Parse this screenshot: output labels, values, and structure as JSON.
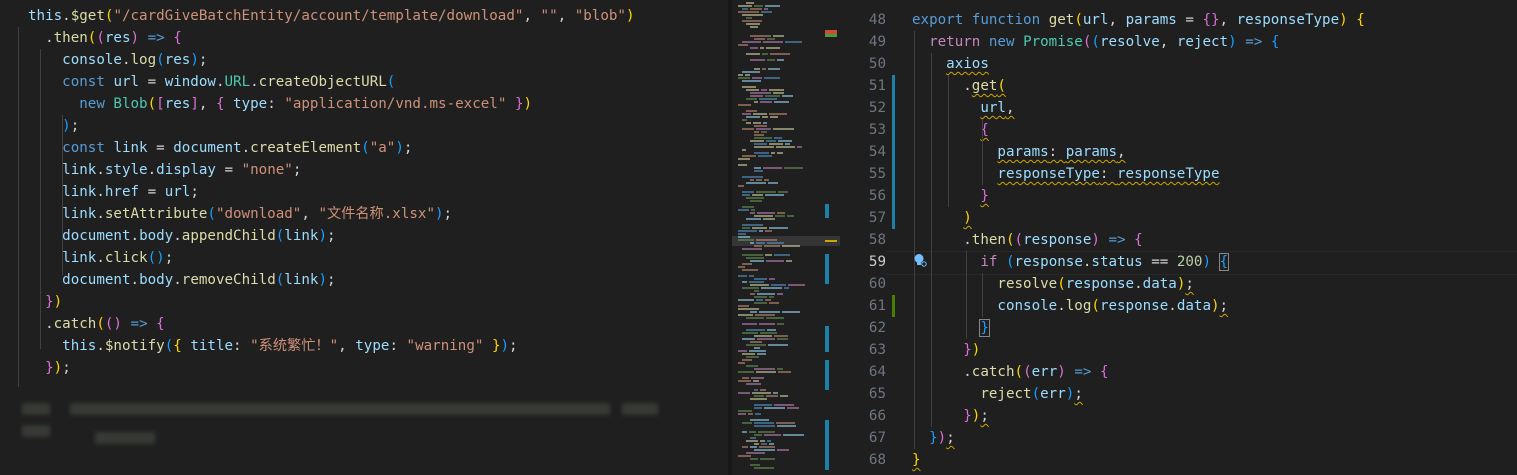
{
  "left": {
    "lines": [
      [
        [
          "var",
          "this"
        ],
        [
          "op",
          "."
        ],
        [
          "fn",
          "$get"
        ],
        [
          "b1",
          "("
        ],
        [
          "str",
          "\"/cardGiveBatchEntity/account/template/download\""
        ],
        [
          "op",
          ", "
        ],
        [
          "str",
          "\"\""
        ],
        [
          "op",
          ", "
        ],
        [
          "str",
          "\"blob\""
        ],
        [
          "b1",
          ")"
        ]
      ],
      [
        [
          "op",
          "  ."
        ],
        [
          "fn",
          "then"
        ],
        [
          "b1",
          "("
        ],
        [
          "b2",
          "("
        ],
        [
          "var",
          "res"
        ],
        [
          "b2",
          ")"
        ],
        [
          "op",
          " "
        ],
        [
          "kw",
          "=>"
        ],
        [
          "op",
          " "
        ],
        [
          "b2",
          "{"
        ]
      ],
      [
        [
          "op",
          "    "
        ],
        [
          "var",
          "console"
        ],
        [
          "op",
          "."
        ],
        [
          "fn",
          "log"
        ],
        [
          "b3",
          "("
        ],
        [
          "var",
          "res"
        ],
        [
          "b3",
          ")"
        ],
        [
          "op",
          ";"
        ]
      ],
      [
        [
          "op",
          "    "
        ],
        [
          "kw",
          "const"
        ],
        [
          "op",
          " "
        ],
        [
          "var",
          "url"
        ],
        [
          "op",
          " = "
        ],
        [
          "var",
          "window"
        ],
        [
          "op",
          "."
        ],
        [
          "cls",
          "URL"
        ],
        [
          "op",
          "."
        ],
        [
          "fn",
          "createObjectURL"
        ],
        [
          "b3",
          "("
        ]
      ],
      [
        [
          "op",
          "      "
        ],
        [
          "kw",
          "new"
        ],
        [
          "op",
          " "
        ],
        [
          "cls",
          "Blob"
        ],
        [
          "b1",
          "("
        ],
        [
          "b2",
          "["
        ],
        [
          "var",
          "res"
        ],
        [
          "b2",
          "]"
        ],
        [
          "op",
          ", "
        ],
        [
          "b2",
          "{"
        ],
        [
          "op",
          " "
        ],
        [
          "var",
          "type"
        ],
        [
          "op",
          ": "
        ],
        [
          "str",
          "\"application/vnd.ms-excel\""
        ],
        [
          "op",
          " "
        ],
        [
          "b2",
          "}"
        ],
        [
          "b1",
          ")"
        ]
      ],
      [
        [
          "op",
          "    "
        ],
        [
          "b3",
          ")"
        ],
        [
          "op",
          ";"
        ]
      ],
      [
        [
          "op",
          "    "
        ],
        [
          "kw",
          "const"
        ],
        [
          "op",
          " "
        ],
        [
          "var",
          "link"
        ],
        [
          "op",
          " = "
        ],
        [
          "var",
          "document"
        ],
        [
          "op",
          "."
        ],
        [
          "fn",
          "createElement"
        ],
        [
          "b3",
          "("
        ],
        [
          "str",
          "\"a\""
        ],
        [
          "b3",
          ")"
        ],
        [
          "op",
          ";"
        ]
      ],
      [
        [
          "op",
          "    "
        ],
        [
          "var",
          "link"
        ],
        [
          "op",
          "."
        ],
        [
          "var",
          "style"
        ],
        [
          "op",
          "."
        ],
        [
          "var",
          "display"
        ],
        [
          "op",
          " = "
        ],
        [
          "str",
          "\"none\""
        ],
        [
          "op",
          ";"
        ]
      ],
      [
        [
          "op",
          "    "
        ],
        [
          "var",
          "link"
        ],
        [
          "op",
          "."
        ],
        [
          "var",
          "href"
        ],
        [
          "op",
          " = "
        ],
        [
          "var",
          "url"
        ],
        [
          "op",
          ";"
        ]
      ],
      [
        [
          "op",
          "    "
        ],
        [
          "var",
          "link"
        ],
        [
          "op",
          "."
        ],
        [
          "fn",
          "setAttribute"
        ],
        [
          "b3",
          "("
        ],
        [
          "str",
          "\"download\""
        ],
        [
          "op",
          ", "
        ],
        [
          "str",
          "\"文件名称.xlsx\""
        ],
        [
          "b3",
          ")"
        ],
        [
          "op",
          ";"
        ]
      ],
      [
        [
          "op",
          "    "
        ],
        [
          "var",
          "document"
        ],
        [
          "op",
          "."
        ],
        [
          "var",
          "body"
        ],
        [
          "op",
          "."
        ],
        [
          "fn",
          "appendChild"
        ],
        [
          "b3",
          "("
        ],
        [
          "var",
          "link"
        ],
        [
          "b3",
          ")"
        ],
        [
          "op",
          ";"
        ]
      ],
      [
        [
          "op",
          "    "
        ],
        [
          "var",
          "link"
        ],
        [
          "op",
          "."
        ],
        [
          "fn",
          "click"
        ],
        [
          "b3",
          "()"
        ],
        [
          "op",
          ";"
        ]
      ],
      [
        [
          "op",
          "    "
        ],
        [
          "var",
          "document"
        ],
        [
          "op",
          "."
        ],
        [
          "var",
          "body"
        ],
        [
          "op",
          "."
        ],
        [
          "fn",
          "removeChild"
        ],
        [
          "b3",
          "("
        ],
        [
          "var",
          "link"
        ],
        [
          "b3",
          ")"
        ],
        [
          "op",
          ";"
        ]
      ],
      [
        [
          "op",
          "  "
        ],
        [
          "b2",
          "}"
        ],
        [
          "b1",
          ")"
        ]
      ],
      [
        [
          "op",
          "  ."
        ],
        [
          "fn",
          "catch"
        ],
        [
          "b1",
          "("
        ],
        [
          "b2",
          "()"
        ],
        [
          "op",
          " "
        ],
        [
          "kw",
          "=>"
        ],
        [
          "op",
          " "
        ],
        [
          "b2",
          "{"
        ]
      ],
      [
        [
          "op",
          "    "
        ],
        [
          "var",
          "this"
        ],
        [
          "op",
          "."
        ],
        [
          "fn",
          "$notify"
        ],
        [
          "b3",
          "("
        ],
        [
          "b1",
          "{"
        ],
        [
          "op",
          " "
        ],
        [
          "var",
          "title"
        ],
        [
          "op",
          ": "
        ],
        [
          "str",
          "\"系统繁忙！\""
        ],
        [
          "op",
          ", "
        ],
        [
          "var",
          "type"
        ],
        [
          "op",
          ": "
        ],
        [
          "str",
          "\"warning\""
        ],
        [
          "op",
          " "
        ],
        [
          "b1",
          "}"
        ],
        [
          "b3",
          ")"
        ],
        [
          "op",
          ";"
        ]
      ],
      [
        [
          "op",
          "  "
        ],
        [
          "b2",
          "}"
        ],
        [
          "b1",
          ")"
        ],
        [
          "op",
          ";"
        ]
      ]
    ]
  },
  "right": {
    "line_numbers": [
      "48",
      "49",
      "50",
      "51",
      "52",
      "53",
      "54",
      "55",
      "56",
      "57",
      "58",
      "59",
      "60",
      "61",
      "62",
      "63",
      "64",
      "65",
      "66",
      "67",
      "68"
    ],
    "active_line": "59",
    "lines": [
      [
        [
          "kw",
          "export"
        ],
        [
          "op",
          " "
        ],
        [
          "kw",
          "function"
        ],
        [
          "op",
          " "
        ],
        [
          "fn",
          "get"
        ],
        [
          "b1",
          "("
        ],
        [
          "var",
          "url"
        ],
        [
          "op",
          ", "
        ],
        [
          "var",
          "params"
        ],
        [
          "op",
          " = "
        ],
        [
          "b2",
          "{}"
        ],
        [
          "op",
          ", "
        ],
        [
          "var",
          "responseType"
        ],
        [
          "b1",
          ")"
        ],
        [
          "op",
          " "
        ],
        [
          "b1",
          "{"
        ]
      ],
      [
        [
          "op",
          "  "
        ],
        [
          "ctl",
          "return"
        ],
        [
          "op",
          " "
        ],
        [
          "kw",
          "new"
        ],
        [
          "op",
          " "
        ],
        [
          "cls",
          "Promise"
        ],
        [
          "b2",
          "("
        ],
        [
          "b3",
          "("
        ],
        [
          "var",
          "resolve"
        ],
        [
          "op",
          ", "
        ],
        [
          "var",
          "reject"
        ],
        [
          "b3",
          ")"
        ],
        [
          "op",
          " "
        ],
        [
          "kw",
          "=>"
        ],
        [
          "op",
          " "
        ],
        [
          "b3",
          "{"
        ]
      ],
      [
        [
          "op",
          "    "
        ],
        [
          "var",
          "axios",
          "sq"
        ]
      ],
      [
        [
          "op",
          "      ."
        ],
        [
          "fn",
          "get",
          "sq"
        ],
        [
          "b1",
          "(",
          "sq"
        ]
      ],
      [
        [
          "op",
          "        "
        ],
        [
          "var",
          "url",
          "sq"
        ],
        [
          "op",
          ",",
          "sq"
        ]
      ],
      [
        [
          "op",
          "        "
        ],
        [
          "b2",
          "{",
          "sq"
        ]
      ],
      [
        [
          "op",
          "          "
        ],
        [
          "var",
          "params",
          "sq"
        ],
        [
          "op",
          ": ",
          "sq"
        ],
        [
          "var",
          "params",
          "sq"
        ],
        [
          "op",
          ",",
          "sq"
        ]
      ],
      [
        [
          "op",
          "          "
        ],
        [
          "var",
          "responseType",
          "sq"
        ],
        [
          "op",
          ": ",
          "sq"
        ],
        [
          "var",
          "responseType",
          "sq"
        ]
      ],
      [
        [
          "op",
          "        "
        ],
        [
          "b2",
          "}",
          "sq"
        ]
      ],
      [
        [
          "op",
          "      "
        ],
        [
          "b1",
          ")",
          "sq"
        ]
      ],
      [
        [
          "op",
          "      ."
        ],
        [
          "fn",
          "then"
        ],
        [
          "b1",
          "("
        ],
        [
          "b2",
          "("
        ],
        [
          "var",
          "response"
        ],
        [
          "b2",
          ")"
        ],
        [
          "op",
          " "
        ],
        [
          "kw",
          "=>"
        ],
        [
          "op",
          " "
        ],
        [
          "b2",
          "{"
        ]
      ],
      [
        [
          "op",
          "        "
        ],
        [
          "ctl",
          "if"
        ],
        [
          "op",
          " "
        ],
        [
          "b3",
          "("
        ],
        [
          "var",
          "response"
        ],
        [
          "op",
          "."
        ],
        [
          "var",
          "status"
        ],
        [
          "op",
          " == "
        ],
        [
          "num",
          "200"
        ],
        [
          "b3",
          ")"
        ],
        [
          "op",
          " "
        ],
        [
          "b3",
          "{",
          "box"
        ]
      ],
      [
        [
          "op",
          "          "
        ],
        [
          "fn",
          "resolve"
        ],
        [
          "b1",
          "("
        ],
        [
          "var",
          "response"
        ],
        [
          "op",
          "."
        ],
        [
          "var",
          "data"
        ],
        [
          "b1",
          ")"
        ],
        [
          "op",
          ";",
          "sq"
        ]
      ],
      [
        [
          "op",
          "          "
        ],
        [
          "var",
          "console"
        ],
        [
          "op",
          "."
        ],
        [
          "fn",
          "log"
        ],
        [
          "b1",
          "("
        ],
        [
          "var",
          "response"
        ],
        [
          "op",
          "."
        ],
        [
          "var",
          "data"
        ],
        [
          "b1",
          ")"
        ],
        [
          "op",
          ";",
          "sq"
        ]
      ],
      [
        [
          "op",
          "        "
        ],
        [
          "b3",
          "}",
          "box"
        ]
      ],
      [
        [
          "op",
          "      "
        ],
        [
          "b2",
          "}"
        ],
        [
          "b1",
          ")"
        ]
      ],
      [
        [
          "op",
          "      ."
        ],
        [
          "fn",
          "catch"
        ],
        [
          "b1",
          "("
        ],
        [
          "b2",
          "("
        ],
        [
          "var",
          "err"
        ],
        [
          "b2",
          ")"
        ],
        [
          "op",
          " "
        ],
        [
          "kw",
          "=>"
        ],
        [
          "op",
          " "
        ],
        [
          "b2",
          "{"
        ]
      ],
      [
        [
          "op",
          "        "
        ],
        [
          "fn",
          "reject"
        ],
        [
          "b3",
          "("
        ],
        [
          "var",
          "err"
        ],
        [
          "b3",
          ")"
        ],
        [
          "op",
          ";",
          "sq"
        ]
      ],
      [
        [
          "op",
          "      "
        ],
        [
          "b2",
          "}"
        ],
        [
          "b1",
          ")"
        ],
        [
          "op",
          ";",
          "sq"
        ]
      ],
      [
        [
          "op",
          "  "
        ],
        [
          "b3",
          "}"
        ],
        [
          "b2",
          ")"
        ],
        [
          "op",
          ";",
          "sq"
        ]
      ],
      [
        [
          "b1",
          "}",
          "sq"
        ]
      ]
    ]
  }
}
